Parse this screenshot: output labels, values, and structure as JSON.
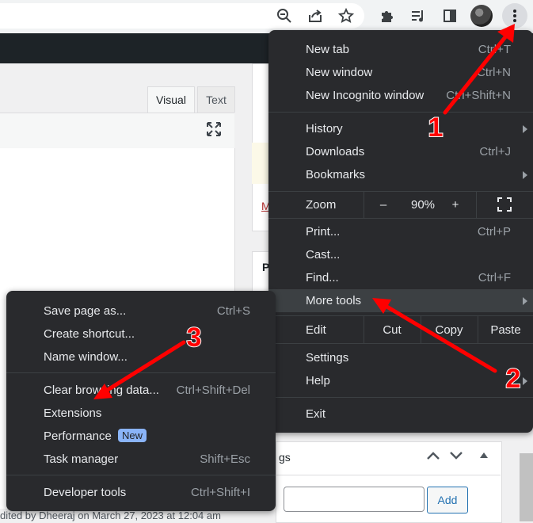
{
  "main_menu": {
    "items": [
      {
        "label": "New tab",
        "shortcut": "Ctrl+T"
      },
      {
        "label": "New window",
        "shortcut": "Ctrl+N"
      },
      {
        "label": "New Incognito window",
        "shortcut": "Ctrl+Shift+N"
      },
      {
        "label": "History",
        "shortcut": ""
      },
      {
        "label": "Downloads",
        "shortcut": "Ctrl+J"
      },
      {
        "label": "Bookmarks",
        "shortcut": ""
      },
      {
        "label": "Print...",
        "shortcut": "Ctrl+P"
      },
      {
        "label": "Cast...",
        "shortcut": ""
      },
      {
        "label": "Find...",
        "shortcut": "Ctrl+F"
      },
      {
        "label": "More tools",
        "shortcut": ""
      },
      {
        "label": "Settings",
        "shortcut": ""
      },
      {
        "label": "Help",
        "shortcut": ""
      },
      {
        "label": "Exit",
        "shortcut": ""
      }
    ],
    "zoom": {
      "label": "Zoom",
      "minus": "–",
      "value": "90%",
      "plus": "+"
    },
    "edit": {
      "label": "Edit",
      "cut": "Cut",
      "copy": "Copy",
      "paste": "Paste"
    }
  },
  "sub_menu": {
    "items": [
      {
        "label": "Save page as...",
        "shortcut": "Ctrl+S"
      },
      {
        "label": "Create shortcut...",
        "shortcut": ""
      },
      {
        "label": "Name window...",
        "shortcut": ""
      },
      {
        "label": "Clear browsing data...",
        "shortcut": "Ctrl+Shift+Del"
      },
      {
        "label": "Extensions",
        "shortcut": ""
      },
      {
        "label": "Performance",
        "shortcut": ""
      },
      {
        "label": "Task manager",
        "shortcut": "Shift+Esc"
      },
      {
        "label": "Developer tools",
        "shortcut": "Ctrl+Shift+I"
      }
    ],
    "new_badge": "New"
  },
  "editor": {
    "tab_visual": "Visual",
    "tab_text": "Text",
    "last_edited": "dited by Dheeraj on March 27, 2023 at 12:04 am"
  },
  "tags": {
    "title": "gs",
    "add_label": "Add"
  },
  "side": {
    "letter_p": "P",
    "letter_m": "M"
  },
  "annotations": [
    {
      "number": "1"
    },
    {
      "number": "2"
    },
    {
      "number": "3"
    }
  ],
  "colors": {
    "menu_bg": "#292a2d",
    "highlight": "#3c4043",
    "arrow": "#ff0000",
    "badge": "#8ab4f8"
  }
}
